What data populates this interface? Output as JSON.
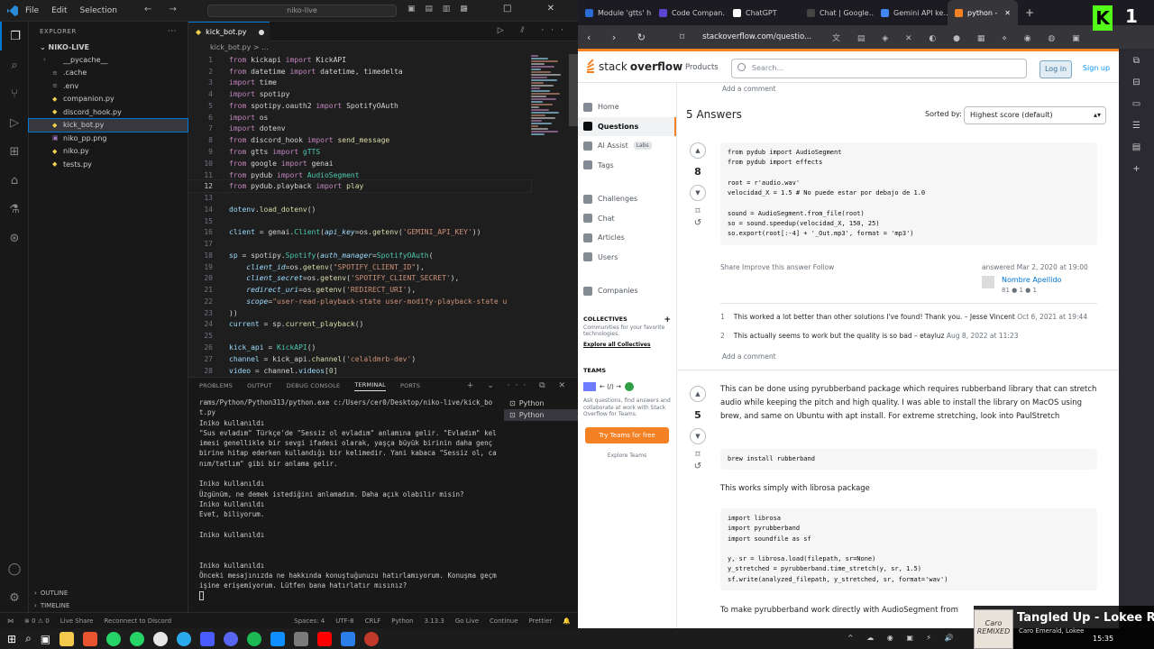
{
  "vscode": {
    "menu": [
      "File",
      "Edit",
      "Selection"
    ],
    "search": "niko-live",
    "explorer_title": "EXPLORER",
    "project": "NIKO-LIVE",
    "files": [
      {
        "name": "__pycache__",
        "kind": "folder"
      },
      {
        "name": ".cache",
        "kind": "file"
      },
      {
        "name": ".env",
        "kind": "file"
      },
      {
        "name": "companion.py",
        "kind": "py"
      },
      {
        "name": "discord_hook.py",
        "kind": "py"
      },
      {
        "name": "kick_bot.py",
        "kind": "py",
        "selected": true
      },
      {
        "name": "niko_pp.png",
        "kind": "img"
      },
      {
        "name": "niko.py",
        "kind": "py"
      },
      {
        "name": "tests.py",
        "kind": "py"
      }
    ],
    "outline": "OUTLINE",
    "timeline": "TIMELINE",
    "tab": "kick_bot.py",
    "breadcrumb": "kick_bot.py > ...",
    "code": [
      [
        [
          "k",
          "from "
        ],
        [
          "p",
          "kickapi "
        ],
        [
          "k",
          "import "
        ],
        [
          "p",
          "KickAPI"
        ]
      ],
      [
        [
          "k",
          "from "
        ],
        [
          "p",
          "datetime "
        ],
        [
          "k",
          "import "
        ],
        [
          "p",
          "datetime, timedelta"
        ]
      ],
      [
        [
          "k",
          "import "
        ],
        [
          "p",
          "time"
        ]
      ],
      [
        [
          "k",
          "import "
        ],
        [
          "p",
          "spotipy"
        ]
      ],
      [
        [
          "k",
          "from "
        ],
        [
          "p",
          "spotipy.oauth2 "
        ],
        [
          "k",
          "import "
        ],
        [
          "p",
          "SpotifyOAuth"
        ]
      ],
      [
        [
          "k",
          "import "
        ],
        [
          "p",
          "os"
        ]
      ],
      [
        [
          "k",
          "import "
        ],
        [
          "p",
          "dotenv"
        ]
      ],
      [
        [
          "k",
          "from "
        ],
        [
          "p",
          "discord_hook "
        ],
        [
          "k",
          "import "
        ],
        [
          "f",
          "send_message"
        ]
      ],
      [
        [
          "k",
          "from "
        ],
        [
          "p",
          "gtts "
        ],
        [
          "k",
          "import "
        ],
        [
          "t",
          "gTTS"
        ]
      ],
      [
        [
          "k",
          "from "
        ],
        [
          "p",
          "google "
        ],
        [
          "k",
          "import "
        ],
        [
          "p",
          "genai"
        ]
      ],
      [
        [
          "k",
          "from "
        ],
        [
          "p",
          "pydub "
        ],
        [
          "k",
          "import "
        ],
        [
          "t",
          "AudioSegment"
        ]
      ],
      [
        [
          "k",
          "from "
        ],
        [
          "p",
          "pydub.playback "
        ],
        [
          "k",
          "import "
        ],
        [
          "f",
          "play"
        ]
      ],
      [],
      [
        [
          "v",
          "dotenv"
        ],
        [
          "p",
          "."
        ],
        [
          "f",
          "load_dotenv"
        ],
        [
          "p",
          "()"
        ]
      ],
      [],
      [
        [
          "v",
          "client "
        ],
        [
          "p",
          "= genai."
        ],
        [
          "t",
          "Client"
        ],
        [
          "p",
          "("
        ],
        [
          "i",
          "api_key"
        ],
        [
          "p",
          "=os."
        ],
        [
          "f",
          "getenv"
        ],
        [
          "p",
          "("
        ],
        [
          "s",
          "'GEMINI_API_KEY'"
        ],
        [
          "p",
          "))"
        ]
      ],
      [],
      [
        [
          "v",
          "sp "
        ],
        [
          "p",
          "= spotipy."
        ],
        [
          "t",
          "Spotify"
        ],
        [
          "p",
          "("
        ],
        [
          "i",
          "auth_manager"
        ],
        [
          "p",
          "="
        ],
        [
          "t",
          "SpotifyOAuth"
        ],
        [
          "p",
          "("
        ]
      ],
      [
        [
          "p",
          "    "
        ],
        [
          "i",
          "client_id"
        ],
        [
          "p",
          "=os."
        ],
        [
          "f",
          "getenv"
        ],
        [
          "p",
          "("
        ],
        [
          "s",
          "\"SPOTIFY_CLIENT_ID\""
        ],
        [
          "p",
          "),"
        ]
      ],
      [
        [
          "p",
          "    "
        ],
        [
          "i",
          "client_secret"
        ],
        [
          "p",
          "=os."
        ],
        [
          "f",
          "getenv"
        ],
        [
          "p",
          "("
        ],
        [
          "s",
          "'SPOTIFY_CLIENT_SECRET'"
        ],
        [
          "p",
          "),"
        ]
      ],
      [
        [
          "p",
          "    "
        ],
        [
          "i",
          "redirect_uri"
        ],
        [
          "p",
          "=os."
        ],
        [
          "f",
          "getenv"
        ],
        [
          "p",
          "("
        ],
        [
          "s",
          "'REDIRECT_URI'"
        ],
        [
          "p",
          "),"
        ]
      ],
      [
        [
          "p",
          "    "
        ],
        [
          "i",
          "scope"
        ],
        [
          "p",
          "="
        ],
        [
          "s",
          "\"user-read-playback-state user-modify-playback-state u"
        ]
      ],
      [
        [
          "p",
          "))"
        ]
      ],
      [
        [
          "v",
          "current "
        ],
        [
          "p",
          "= sp."
        ],
        [
          "f",
          "current_playback"
        ],
        [
          "p",
          "()"
        ]
      ],
      [],
      [
        [
          "v",
          "kick_api "
        ],
        [
          "p",
          "= "
        ],
        [
          "t",
          "KickAPI"
        ],
        [
          "p",
          "()"
        ]
      ],
      [
        [
          "v",
          "channel "
        ],
        [
          "p",
          "= kick_api."
        ],
        [
          "f",
          "channel"
        ],
        [
          "p",
          "("
        ],
        [
          "s",
          "'celaldmrb-dev'"
        ],
        [
          "p",
          ")"
        ]
      ],
      [
        [
          "v",
          "video "
        ],
        [
          "p",
          "= channel."
        ],
        [
          "v",
          "videos"
        ],
        [
          "p",
          "["
        ],
        [
          "n",
          "0"
        ],
        [
          "p",
          "]"
        ]
      ]
    ],
    "panel_tabs": [
      "PROBLEMS",
      "OUTPUT",
      "DEBUG CONSOLE",
      "TERMINAL",
      "PORTS"
    ],
    "terminal": [
      "rams/Python/Python313/python.exe c:/Users/cer0/Desktop/niko-live/kick_bot.py",
      "Iniko kullanıldı",
      "\"Sus evladım\" Türkçe'de \"Sessiz ol evladım\" anlamına gelir. \"Evladım\" kelimesi genellikle bir sevgi ifadesi olarak, yaşça büyük birinin daha genç birine hitap ederken kullandığı bir kelimedir. Yani kabaca \"Sessiz ol, canım/tatlım\" gibi bir anlama gelir.",
      "",
      "Iniko kullanıldı",
      "Üzgünüm, ne demek istediğini anlamadım. Daha açık olabilir misin?",
      "Iniko kullanıldı",
      "Evet, biliyorum.",
      "",
      "Iniko kullanıldı",
      "",
      "",
      "Iniko kullanıldı",
      "Önceki mesajınızda ne hakkında konuştuğunuzu hatırlamıyorum. Konuşma geçmişine erişemiyorum. Lütfen bana hatırlatır mısınız?"
    ],
    "term_list": [
      "Python",
      "Python"
    ],
    "status": {
      "live": "Live Share",
      "discord": "Reconnect to Discord",
      "spaces": "Spaces: 4",
      "enc": "UTF-8",
      "eol": "CRLF",
      "lang": "Python",
      "ver": "3.13.3",
      "golive": "Go Live",
      "cont": "Continue",
      "prettier": "Prettier"
    }
  },
  "browser": {
    "tabs": [
      {
        "label": "Module 'gtts' h…",
        "color": "#2a6cd6"
      },
      {
        "label": "Code Compan…",
        "color": "#5a46d0"
      },
      {
        "label": "ChatGPT",
        "color": "#ffffff"
      },
      {
        "label": "Chat | Google…",
        "color": "#444444"
      },
      {
        "label": "Gemini API ke…",
        "color": "#4285f4"
      },
      {
        "label": "python -",
        "color": "#f48225",
        "active": true
      }
    ],
    "url": "stackoverflow.com/questio...",
    "so": {
      "logo_a": "stack",
      "logo_b": "overflow",
      "products": "Products",
      "search": "Search...",
      "login": "Log in",
      "signup": "Sign up",
      "left": [
        "Home",
        "Questions",
        "AI Assist",
        "Tags",
        "Challenges",
        "Chat",
        "Articles",
        "Users",
        "Companies"
      ],
      "ai_badge": "Labs",
      "collectives": "COLLECTIVES",
      "coll_text": "Communities for your favorite technologies.",
      "coll_link": "Explore all Collectives",
      "teams": "TEAMS",
      "teams_text": "Ask questions, find answers and collaborate at work with Stack Overflow for Teams.",
      "teams_btn": "Try Teams for free",
      "teams_link": "Explore Teams",
      "add_comment": "Add a comment",
      "answers": "5 Answers",
      "sorted_by": "Sorted by:",
      "sort": "Highest score (default)",
      "a1": {
        "score": "8",
        "code": "from pydub import AudioSegment\nfrom pydub import effects\n\nroot = r'audio.wav'\nvelocidad_X = 1.5 # No puede estar por debajo de 1.0\n\nsound = AudioSegment.from_file(root)\nso = sound.speedup(velocidad_X, 150, 25)\nso.export(root[:-4] + '_Out.mp3', format = 'mp3')",
        "links": "Share  Improve this answer  Follow",
        "answered": "answered Mar 2, 2020 at 19:00",
        "user": "Nombre Apellido",
        "stats": "81 ● 1 ● 1",
        "c1": "This worked a lot better than other solutions I've found! Thank you. – Jesse Vincent",
        "c1d": "Oct 6, 2021 at 19:44",
        "c2": "This actually seems to work but the quality is so bad – etayluz",
        "c2d": "Aug 8, 2022 at 11:23"
      },
      "a2": {
        "score": "5",
        "text": "This can be done using pyrubberband package which requires rubberband library that can stretch audio while keeping the pitch and high quality. I was able to install the library on MacOS using brew, and same on Ubuntu with apt install. For extreme stretching, look into PaulStretch",
        "code1": "brew install rubberband",
        "text2": "This works simply with librosa package",
        "code2": "import librosa\nimport pyrubberband\nimport soundfile as sf\n\ny, sr = librosa.load(filepath, sr=None)\ny_stretched = pyrubberband.time_stretch(y, sr, 1.5)\nsf.write(analyzed_filepath, y_stretched, sr, format='wav')",
        "text3": "To make pyrubberband work directly with AudioSegment from"
      }
    }
  },
  "media": {
    "title": "Tangled Up - Lokee R...",
    "artist": "Caro Emerald, Lokee",
    "cover": "Caro REMIXED"
  },
  "clock": "15:35",
  "badge": "1"
}
